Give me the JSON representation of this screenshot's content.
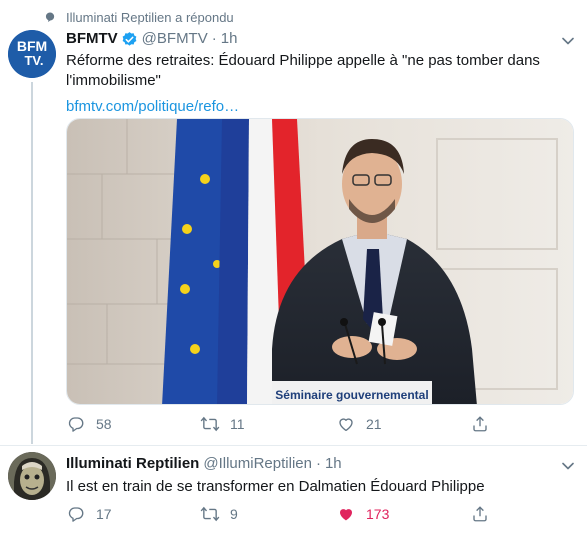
{
  "context": {
    "icon": "bubble-icon",
    "text": "Illuminati Reptilien a répondu"
  },
  "tweets": [
    {
      "avatar_icon": "bfmtv-logo",
      "avatar_text": "BFM TV.",
      "name": "BFMTV",
      "verified": true,
      "handle": "@BFMTV",
      "time": "1h",
      "text": "Réforme des retraites: Édouard Philippe appelle à \"ne pas tomber dans l'immobilisme\"",
      "link": "bfmtv.com/politique/refo…",
      "media": {
        "podium_text": "Séminaire gouvernemental"
      },
      "actions": {
        "reply_count": "58",
        "retweet_count": "11",
        "like_count": "21"
      }
    },
    {
      "avatar_icon": "user-avatar",
      "name": "Illuminati Reptilien",
      "handle": "@IllumiReptilien",
      "time": "1h",
      "text": "Il est en train de se transformer en Dalmatien Édouard Philippe",
      "actions": {
        "reply_count": "17",
        "retweet_count": "9",
        "like_count": "173",
        "liked": true
      }
    }
  ],
  "colors": {
    "accent": "#1da1f2",
    "link": "#1b95e0",
    "secondary_text": "#657786",
    "like": "#e0245e",
    "divider": "#e6ecf0"
  }
}
